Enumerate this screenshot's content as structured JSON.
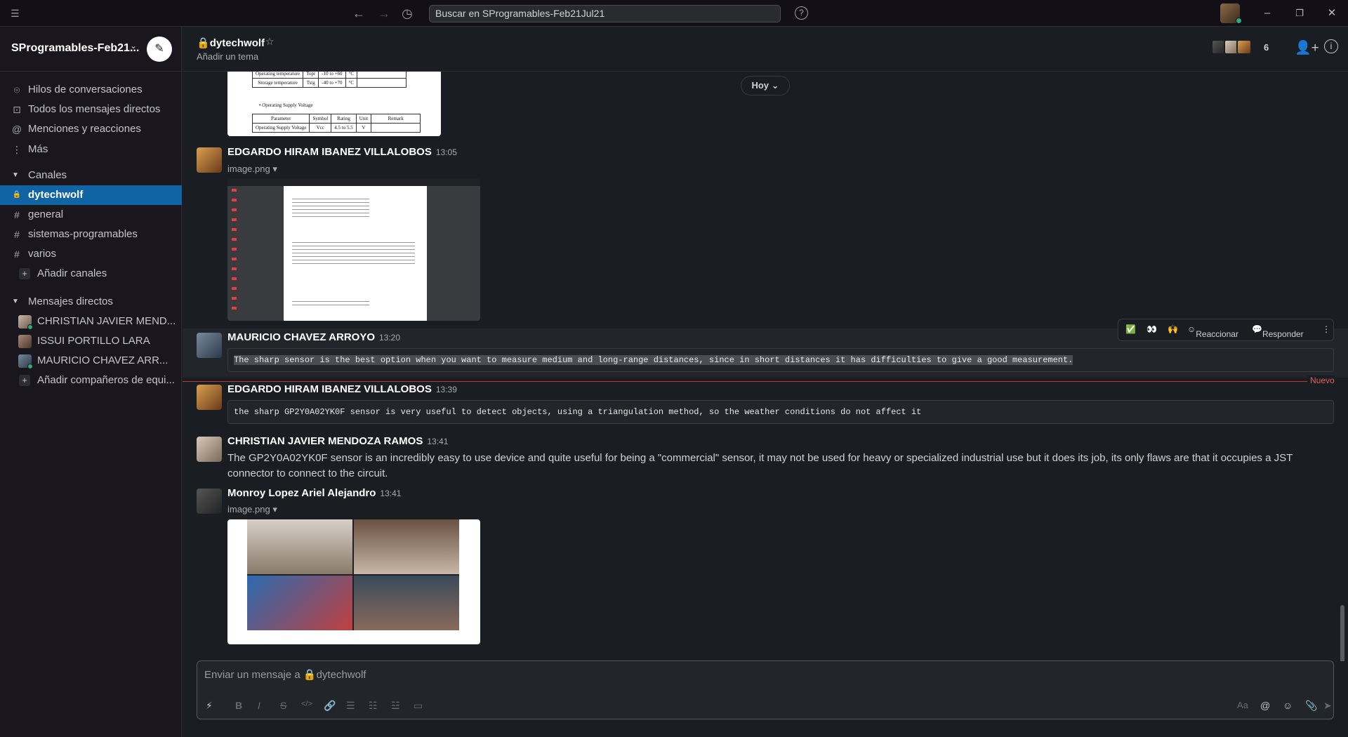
{
  "topbar": {
    "search_placeholder": "Buscar en SProgramables-Feb21Jul21",
    "nav": {
      "back": "←",
      "forward": "→",
      "history": "◷",
      "help": "?"
    },
    "window": {
      "minimize": "–",
      "maximize": "❐",
      "close": "✕"
    }
  },
  "sidebar": {
    "workspace": "SProgramables-Feb21...",
    "nav_items": [
      {
        "icon": "threads-icon",
        "glyph": "⌾",
        "label": "Hilos de conversaciones"
      },
      {
        "icon": "dm-icon",
        "glyph": "⊡",
        "label": "Todos los mensajes directos"
      },
      {
        "icon": "at-icon",
        "glyph": "@",
        "label": "Menciones y reacciones"
      },
      {
        "icon": "more-icon",
        "glyph": "⋮",
        "label": "Más"
      }
    ],
    "channels_section": "Canales",
    "channels": [
      {
        "glyph": "🔒",
        "label": "dytechwolf"
      },
      {
        "glyph": "#",
        "label": "general"
      },
      {
        "glyph": "#",
        "label": "sistemas-programables"
      },
      {
        "glyph": "#",
        "label": "varios"
      }
    ],
    "add_channels": "Añadir canales",
    "dm_section": "Mensajes directos",
    "dms": [
      {
        "label": "CHRISTIAN JAVIER MEND..."
      },
      {
        "label": "ISSUI PORTILLO LARA"
      },
      {
        "label": "MAURICIO CHAVEZ ARR..."
      }
    ],
    "add_teammates": "Añadir compañeros de equi..."
  },
  "channel": {
    "name": "dytechwolf",
    "topic": "Añadir un tema",
    "member_count": "6"
  },
  "doc_table": {
    "rows1": [
      [
        "Operating temperature",
        "Topr",
        "-10 to +60",
        "°C",
        ""
      ],
      [
        "Storage temperature",
        "Tstg",
        "-40 to +70",
        "°C",
        ""
      ]
    ],
    "supply_title": "• Operating Supply Voltage",
    "header2": [
      "Parameter",
      "Symbol",
      "Rating",
      "Unit",
      "Remark"
    ],
    "rows2": [
      [
        "Operating Supply Voltage",
        "Vcc",
        "4.5 to 5.5",
        "V",
        ""
      ]
    ]
  },
  "date_divider": "Hoy",
  "messages": [
    {
      "author": "EDGARDO HIRAM IBANEZ VILLALOBOS",
      "time": "13:05",
      "file": "image.png"
    },
    {
      "author": "MAURICIO CHAVEZ ARROYO",
      "time": "13:20",
      "code": "The sharp sensor is the best option when you want to measure medium and long-range distances, since in short distances it has difficulties to give a good measurement."
    },
    {
      "author": "EDGARDO HIRAM IBANEZ VILLALOBOS",
      "time": "13:39",
      "code": "the sharp GP2Y0A02YK0F sensor is very useful to detect objects, using a triangulation method, so the weather conditions do not affect it"
    },
    {
      "author": "CHRISTIAN JAVIER MENDOZA RAMOS",
      "time": "13:41",
      "text": "The GP2Y0A02YK0F sensor is an incredibly easy to use device and quite useful for being a \"commercial\" sensor, it may not be used for heavy or specialized industrial use but it does its job, its only flaws are that it occupies a JST connector to connect to the circuit."
    },
    {
      "author": "Monroy Lopez Ariel Alejandro",
      "time": "13:41",
      "file": "image.png"
    }
  ],
  "hover_actions": {
    "check": "✅",
    "eyes": "👀",
    "hands": "🙌",
    "react": "Reaccionar",
    "reply": "Responder",
    "more": "⋮"
  },
  "new_marker": "Nuevo",
  "composer": {
    "placeholder": "Enviar un mensaje a 🔒dytechwolf",
    "tools": [
      "⚡",
      "B",
      "I",
      "S",
      "</>",
      "🔗",
      "☰",
      "☷",
      "☳",
      "▭"
    ],
    "right_tools": [
      "Aa",
      "@",
      "☺",
      "📎",
      "➤"
    ]
  }
}
